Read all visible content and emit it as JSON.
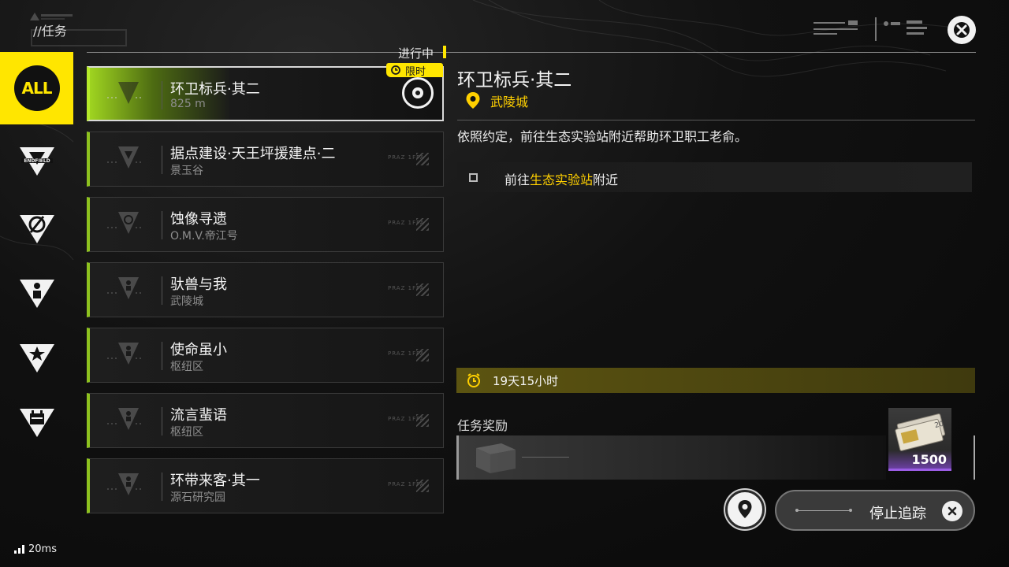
{
  "header": {
    "title": "//任务",
    "close_icon": "close-icon"
  },
  "sidebar": {
    "items": [
      {
        "label": "ALL",
        "icon": "all-icon",
        "active": true
      },
      {
        "label": "ENDFIELD",
        "icon": "endfield-icon",
        "active": false
      },
      {
        "label": "",
        "icon": "compass-icon",
        "active": false
      },
      {
        "label": "",
        "icon": "person-icon",
        "active": false
      },
      {
        "label": "",
        "icon": "star-icon",
        "active": false
      },
      {
        "label": "",
        "icon": "calendar-icon",
        "active": false
      }
    ],
    "ping": "20ms"
  },
  "list": {
    "status_label": "进行中",
    "limited_label": "限时",
    "quests": [
      {
        "name": "环卫标兵·其二",
        "sub": "825 m",
        "code": "",
        "selected": true
      },
      {
        "name": "据点建设·天王坪援建点·二",
        "sub": "景玉谷",
        "code": "PRAZ 1FPA",
        "selected": false
      },
      {
        "name": "蚀像寻遗",
        "sub": "O.M.V.帝江号",
        "code": "PRAZ 1FPA",
        "selected": false
      },
      {
        "name": "驮兽与我",
        "sub": "武陵城",
        "code": "PRAZ 1FPA",
        "selected": false
      },
      {
        "name": "使命虽小",
        "sub": "枢纽区",
        "code": "PRAZ 1FPA",
        "selected": false
      },
      {
        "name": "流言蜚语",
        "sub": "枢纽区",
        "code": "PRAZ 1FPA",
        "selected": false
      },
      {
        "name": "环带来客·其一",
        "sub": "源石研究园",
        "code": "PRAZ 1FPA",
        "selected": false
      }
    ]
  },
  "detail": {
    "title": "环卫标兵·其二",
    "location": "武陵城",
    "description": "依照约定，前往生态实验站附近帮助环卫职工老俞。",
    "objective_prefix": "前往",
    "objective_highlight": "生态实验站",
    "objective_suffix": "附近",
    "timer": "19天15小时",
    "reward_label": "任务奖励",
    "reward_count": "1500",
    "reward_item_icon": "currency-bundle-icon"
  },
  "actions": {
    "map_icon": "location-pin-icon",
    "stop_label": "停止追踪"
  },
  "colors": {
    "accent_yellow": "#ffe600",
    "accent_green": "#8ec21f",
    "highlight_text": "#ffd000",
    "rare_purple": "#9b5de5"
  }
}
